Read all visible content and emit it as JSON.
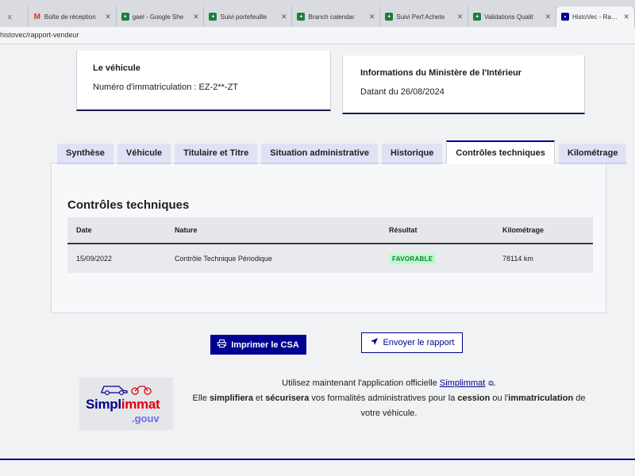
{
  "browser": {
    "tabs": [
      {
        "title": "x",
        "icon": "",
        "color": "#888888"
      },
      {
        "title": "Boîte de réception",
        "icon": "M",
        "color": "#d93025"
      },
      {
        "title": "gael - Google She",
        "icon": "+",
        "color": "#188038"
      },
      {
        "title": "Suivi portefeuille",
        "icon": "+",
        "color": "#188038"
      },
      {
        "title": "Branch calendar",
        "icon": "+",
        "color": "#188038"
      },
      {
        "title": "Suivi Perf Achete",
        "icon": "+",
        "color": "#188038"
      },
      {
        "title": "Validations Qualit",
        "icon": "+",
        "color": "#188038"
      },
      {
        "title": "HistoVec - Rappor",
        "icon": "▪",
        "color": "#000091"
      }
    ],
    "url": "histovec/rapport-vendeur"
  },
  "vehicle_card": {
    "title": "Le véhicule",
    "label": "Numéro d'immatriculation : EZ-2**-ZT"
  },
  "ministry_card": {
    "title": "Informations du Ministère de l'Intérieur",
    "date_text": "Datant du 26/08/2024"
  },
  "tabs": [
    {
      "label": "Synthèse",
      "active": false
    },
    {
      "label": "Véhicule",
      "active": false
    },
    {
      "label": "Titulaire et Titre",
      "active": false
    },
    {
      "label": "Situation administrative",
      "active": false
    },
    {
      "label": "Historique",
      "active": false
    },
    {
      "label": "Contrôles techniques",
      "active": true
    },
    {
      "label": "Kilométrage",
      "active": false
    }
  ],
  "section": {
    "heading": "Contrôles techniques",
    "columns": [
      "Date",
      "Nature",
      "Résultat",
      "Kilométrage"
    ],
    "rows": [
      {
        "date": "15/09/2022",
        "nature": "Contrôle Technique Périodique",
        "result": "FAVORABLE",
        "mileage": "78114 km"
      }
    ]
  },
  "actions": {
    "print_label": "Imprimer le CSA",
    "send_label": "Envoyer le rapport"
  },
  "promo": {
    "line1_prefix": "Utilisez maintenant l'application officielle ",
    "link": "Simplimmat",
    "line1_suffix": ".",
    "line2_a": "Elle ",
    "line2_b": "simplifiera",
    "line2_c": " et ",
    "line2_d": "sécurisera",
    "line2_e": " vos formalités administratives pour la ",
    "line2_f": "cession",
    "line2_g": " ou l'",
    "line2_h": "immatriculation",
    "line2_i": " de",
    "line3": "votre véhicule."
  },
  "logo": {
    "word_a": "Simpl",
    "word_b": "immat",
    "gouv": ".gouv"
  },
  "colors": {
    "primary": "#000091",
    "success_text": "#18753c",
    "success_bg": "#b8fec9",
    "tab_bg": "#e1e1f6"
  }
}
